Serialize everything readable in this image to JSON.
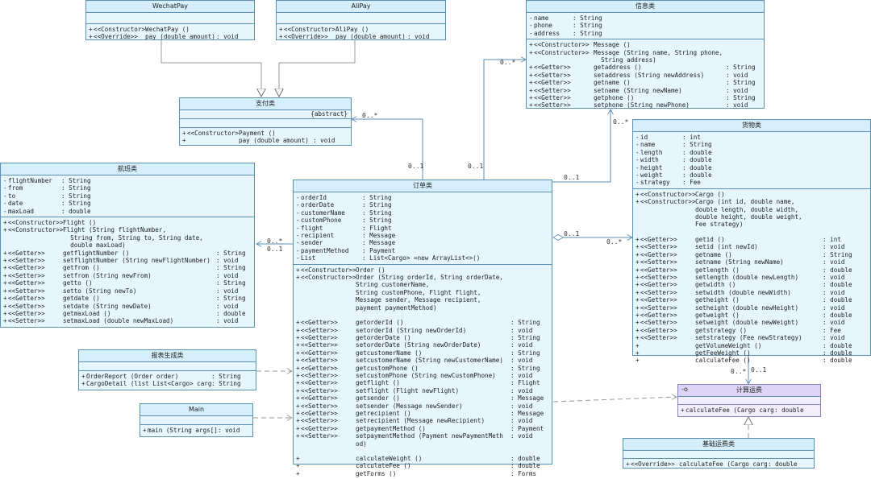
{
  "classes": {
    "wechat": {
      "name": "WechatPay",
      "methods": [
        {
          "v": "+",
          "st": "<<Constructor>>",
          "sig": "WechatPay ()",
          "t": ""
        },
        {
          "v": "+",
          "st": "<<Override>>",
          "sig": "pay (double amount)",
          "t": ": void"
        }
      ]
    },
    "ali": {
      "name": "AliPay",
      "methods": [
        {
          "v": "+",
          "st": "<<Constructor>>",
          "sig": "AliPay ()",
          "t": ""
        },
        {
          "v": "+",
          "st": "<<Override>>",
          "sig": "pay (double amount)",
          "t": ": void"
        }
      ]
    },
    "zhifu": {
      "name": "支付类",
      "stereotype": "{abstract}",
      "methods": [
        {
          "v": "+",
          "st": "<<Constructor>>",
          "sig": "Payment ()",
          "t": ""
        },
        {
          "v": "+",
          "st": "",
          "sig": "pay (double amount)",
          "t": ": void"
        }
      ]
    },
    "xinxi": {
      "name": "信息类",
      "fields": [
        {
          "v": "-",
          "n": "name",
          "t": ": String"
        },
        {
          "v": "-",
          "n": "phone",
          "t": ": String"
        },
        {
          "v": "-",
          "n": "address",
          "t": ": String"
        }
      ],
      "methods": [
        {
          "v": "+",
          "st": "<<Constructor>>",
          "sig": "Message ()",
          "t": ""
        },
        {
          "v": "+",
          "st": "<<Constructor>>",
          "sig": "Message (String name, String phone,\n  String address)",
          "t": ""
        },
        {
          "v": "+",
          "st": "<<Getter>>",
          "sig": "getaddress ()",
          "t": ": String"
        },
        {
          "v": "+",
          "st": "<<Setter>>",
          "sig": "setaddress (String newAddress)",
          "t": ": void"
        },
        {
          "v": "+",
          "st": "<<Getter>>",
          "sig": "getname ()",
          "t": ": String"
        },
        {
          "v": "+",
          "st": "<<Setter>>",
          "sig": "setname (String newName)",
          "t": ": void"
        },
        {
          "v": "+",
          "st": "<<Getter>>",
          "sig": "getphone ()",
          "t": ": String"
        },
        {
          "v": "+",
          "st": "<<Setter>>",
          "sig": "setphone (String newPhone)",
          "t": ": void"
        }
      ]
    },
    "hangban": {
      "name": "航班类",
      "fields": [
        {
          "v": "-",
          "n": "flightNumber",
          "t": ": String"
        },
        {
          "v": "-",
          "n": "from",
          "t": ": String"
        },
        {
          "v": "-",
          "n": "to",
          "t": ": String"
        },
        {
          "v": "-",
          "n": "date",
          "t": ": String"
        },
        {
          "v": "-",
          "n": "maxLoad",
          "t": ": double"
        }
      ],
      "methods": [
        {
          "v": "+",
          "st": "<<Constructor>>",
          "sig": "Flight ()",
          "t": ""
        },
        {
          "v": "+",
          "st": "<<Constructor>>",
          "sig": "Flight (String flightNumber,\n  String from, String to, String date,\n  double maxLoad)",
          "t": ""
        },
        {
          "v": "+",
          "st": "<<Getter>>",
          "sig": "getflightNumber ()",
          "t": ": String"
        },
        {
          "v": "+",
          "st": "<<Setter>>",
          "sig": "setflightNumber (String newFlightNumber)",
          "t": ": void"
        },
        {
          "v": "+",
          "st": "<<Getter>>",
          "sig": "getfrom ()",
          "t": ": String"
        },
        {
          "v": "+",
          "st": "<<Setter>>",
          "sig": "setfrom (String newFrom)",
          "t": ": void"
        },
        {
          "v": "+",
          "st": "<<Getter>>",
          "sig": "getto ()",
          "t": ": String"
        },
        {
          "v": "+",
          "st": "<<Setter>>",
          "sig": "setto (String newTo)",
          "t": ": void"
        },
        {
          "v": "+",
          "st": "<<Getter>>",
          "sig": "getdate ()",
          "t": ": String"
        },
        {
          "v": "+",
          "st": "<<Setter>>",
          "sig": "setdate (String newDate)",
          "t": ": void"
        },
        {
          "v": "+",
          "st": "<<Getter>>",
          "sig": "getmaxLoad ()",
          "t": ": double"
        },
        {
          "v": "+",
          "st": "<<Setter>>",
          "sig": "setmaxLoad (double newMaxLoad)",
          "t": ": void"
        }
      ]
    },
    "dingdan": {
      "name": "订单类",
      "fields": [
        {
          "v": "-",
          "n": "orderId",
          "t": ": String"
        },
        {
          "v": "-",
          "n": "orderDate",
          "t": ": String"
        },
        {
          "v": "-",
          "n": "customerName",
          "t": ": String"
        },
        {
          "v": "-",
          "n": "customPhone",
          "t": ": String"
        },
        {
          "v": "-",
          "n": "flight",
          "t": ": Flight"
        },
        {
          "v": "-",
          "n": "recipient",
          "t": ": Message"
        },
        {
          "v": "-",
          "n": "sender",
          "t": ": Message"
        },
        {
          "v": "-",
          "n": "paymentMethod",
          "t": ": Payment"
        },
        {
          "v": "-",
          "n": "List",
          "t": ": List<Cargo> =new ArrayList<>()"
        }
      ],
      "methods": [
        {
          "v": "+",
          "st": "<<Constructor>>",
          "sig": "Order ()",
          "t": ""
        },
        {
          "v": "+",
          "st": "<<Constructor>>",
          "sig": "Order (String orderId, String orderDate,\nString customerName,\nString customPhone, Flight flight,\nMessage sender, Message recipient,\npayment paymentMethod)",
          "t": ""
        },
        {
          "v": "",
          "st": "",
          "sig": "",
          "t": ""
        },
        {
          "v": "+",
          "st": "<<Getter>>",
          "sig": "getorderId ()",
          "t": ": String"
        },
        {
          "v": "+",
          "st": "<<Setter>>",
          "sig": "setorderId (String newOrderId)",
          "t": ": void"
        },
        {
          "v": "+",
          "st": "<<Getter>>",
          "sig": "getorderDate ()",
          "t": ": String"
        },
        {
          "v": "+",
          "st": "<<Setter>>",
          "sig": "setorderDate (String newOrderDate)",
          "t": ": void"
        },
        {
          "v": "+",
          "st": "<<Getter>>",
          "sig": "getcustomerName ()",
          "t": ": String"
        },
        {
          "v": "+",
          "st": "<<Setter>>",
          "sig": "setcustomerName (String newCustomerName)",
          "t": ": void"
        },
        {
          "v": "+",
          "st": "<<Getter>>",
          "sig": "getcustomPhone ()",
          "t": ": String"
        },
        {
          "v": "+",
          "st": "<<Setter>>",
          "sig": "setcustomPhone (String newCustomPhone)",
          "t": ": void"
        },
        {
          "v": "+",
          "st": "<<Getter>>",
          "sig": "getflight ()",
          "t": ": Flight"
        },
        {
          "v": "+",
          "st": "<<Setter>>",
          "sig": "setflight (Flight newFlight)",
          "t": ": void"
        },
        {
          "v": "+",
          "st": "<<Getter>>",
          "sig": "getsender ()",
          "t": ": Message"
        },
        {
          "v": "+",
          "st": "<<Setter>>",
          "sig": "setsender (Message newSender)",
          "t": ": void"
        },
        {
          "v": "+",
          "st": "<<Getter>>",
          "sig": "getrecipient ()",
          "t": ": Message"
        },
        {
          "v": "+",
          "st": "<<Setter>>",
          "sig": "setrecipient (Message newRecipient)",
          "t": ": void"
        },
        {
          "v": "+",
          "st": "<<Getter>>",
          "sig": "getpaymentMethod ()",
          "t": ": Payment"
        },
        {
          "v": "+",
          "st": "<<Setter>>",
          "sig": "setpaymentMethod (Payment newPaymentMeth\nod)",
          "t": ": void"
        },
        {
          "v": "",
          "st": "",
          "sig": "",
          "t": ""
        },
        {
          "v": "+",
          "st": "",
          "sig": "calculateWeight ()",
          "t": ": double"
        },
        {
          "v": "+",
          "st": "",
          "sig": "calculateFee ()",
          "t": ": double"
        },
        {
          "v": "+",
          "st": "",
          "sig": "getForms ()",
          "t": ": Forms"
        }
      ]
    },
    "huowu": {
      "name": "货物类",
      "fields": [
        {
          "v": "-",
          "n": "id",
          "t": ": int"
        },
        {
          "v": "-",
          "n": "name",
          "t": ": String"
        },
        {
          "v": "-",
          "n": "length",
          "t": ": double"
        },
        {
          "v": "-",
          "n": "width",
          "t": ": double"
        },
        {
          "v": "-",
          "n": "height",
          "t": ": double"
        },
        {
          "v": "-",
          "n": "weight",
          "t": ": double"
        },
        {
          "v": "-",
          "n": "strategy",
          "t": ": Fee"
        }
      ],
      "methods": [
        {
          "v": "+",
          "st": "<<Constructor>>",
          "sig": "Cargo ()",
          "t": ""
        },
        {
          "v": "+",
          "st": "<<Constructor>>",
          "sig": "Cargo (int id, double name,\ndouble length, double width,\ndouble height, double weight,\nFee strategy)",
          "t": ""
        },
        {
          "v": "",
          "st": "",
          "sig": "",
          "t": ""
        },
        {
          "v": "+",
          "st": "<<Getter>>",
          "sig": "getid ()",
          "t": ": int"
        },
        {
          "v": "+",
          "st": "<<Setter>>",
          "sig": "setid (int newId)",
          "t": ": void"
        },
        {
          "v": "+",
          "st": "<<Getter>>",
          "sig": "getname ()",
          "t": ": String"
        },
        {
          "v": "+",
          "st": "<<Setter>>",
          "sig": "setname (String newName)",
          "t": ": void"
        },
        {
          "v": "+",
          "st": "<<Getter>>",
          "sig": "getlength ()",
          "t": ": double"
        },
        {
          "v": "+",
          "st": "<<Setter>>",
          "sig": "setlength (double newLength)",
          "t": ": void"
        },
        {
          "v": "+",
          "st": "<<Getter>>",
          "sig": "getwidth ()",
          "t": ": double"
        },
        {
          "v": "+",
          "st": "<<Setter>>",
          "sig": "setwidth (double newWidth)",
          "t": ": void"
        },
        {
          "v": "+",
          "st": "<<Getter>>",
          "sig": "getheight ()",
          "t": ": double"
        },
        {
          "v": "+",
          "st": "<<Setter>>",
          "sig": "setheight (double newHeight)",
          "t": ": void"
        },
        {
          "v": "+",
          "st": "<<Getter>>",
          "sig": "getweight ()",
          "t": ": double"
        },
        {
          "v": "+",
          "st": "<<Setter>>",
          "sig": "setweight (double newWeight)",
          "t": ": void"
        },
        {
          "v": "+",
          "st": "<<Getter>>",
          "sig": "getstrategy ()",
          "t": ": Fee"
        },
        {
          "v": "+",
          "st": "<<Setter>>",
          "sig": "setstrategy (Fee newStrategy)",
          "t": ": void"
        },
        {
          "v": "+",
          "st": "",
          "sig": "getVolumeWeight ()",
          "t": ": double"
        },
        {
          "v": "+",
          "st": "",
          "sig": "getFeeWeight ()",
          "t": ": double"
        },
        {
          "v": "+",
          "st": "",
          "sig": "calculateFee ()",
          "t": ": double"
        }
      ]
    },
    "baobiao": {
      "name": "报表生成类",
      "methods": [
        {
          "v": "+",
          "st": "",
          "sig": "OrderReport (Order order)",
          "t": ": String"
        },
        {
          "v": "+",
          "st": "",
          "sig": "CargoDetail (list List<Cargo> cargos)",
          "t": ": String"
        }
      ]
    },
    "main": {
      "name": "Main",
      "methods": [
        {
          "v": "+",
          "st": "",
          "sig": "main (String args[])",
          "t": ": void"
        }
      ]
    },
    "jisuan": {
      "name": "计算运费",
      "icon": "-o",
      "methods": [
        {
          "v": "+",
          "st": "",
          "sig": "calculateFee (Cargo cargo)",
          "t": ": double"
        }
      ]
    },
    "jichu": {
      "name": "基础运费类",
      "methods": [
        {
          "v": "+",
          "st": "<<Override>>",
          "sig": "calculateFee (Cargo cargo)",
          "t": ": double"
        }
      ]
    }
  },
  "multiplicities": {
    "order_payment_top": "0..*",
    "order_payment_bottom": "0..1",
    "order_message_top": "0..*",
    "order_message_bottom": "0..1",
    "order_message2_top": "0..*",
    "order_message2_bottom": "0..1",
    "order_flight_a": "0..*",
    "order_flight_b": "0..1",
    "order_cargo_left": "0..1",
    "order_cargo_right": "0..*",
    "cargo_fee_left": "0..*",
    "cargo_fee_right": "0..1"
  }
}
